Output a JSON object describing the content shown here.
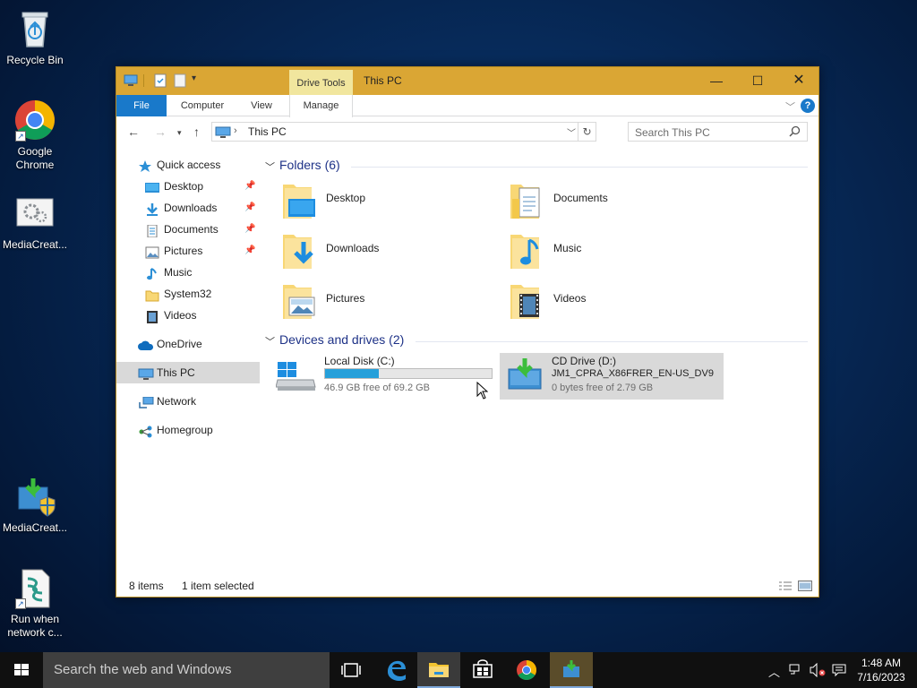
{
  "desktop": {
    "icons": [
      {
        "label": "Recycle Bin"
      },
      {
        "label": "Google Chrome"
      },
      {
        "label": "MediaCreat..."
      },
      {
        "label": "MediaCreat..."
      },
      {
        "label": "Run when network c..."
      }
    ]
  },
  "window": {
    "title": "This PC",
    "context_tab": "Drive Tools",
    "ribbon_tabs": [
      "File",
      "Computer",
      "View",
      "Manage"
    ],
    "help": "?",
    "address": {
      "path": "This PC"
    },
    "search": {
      "placeholder": "Search This PC"
    }
  },
  "navpane": {
    "items": [
      {
        "label": "Quick access"
      },
      {
        "label": "Desktop",
        "pinned": true
      },
      {
        "label": "Downloads",
        "pinned": true
      },
      {
        "label": "Documents",
        "pinned": true
      },
      {
        "label": "Pictures",
        "pinned": true
      },
      {
        "label": "Music"
      },
      {
        "label": "System32"
      },
      {
        "label": "Videos"
      },
      {
        "label": "OneDrive"
      },
      {
        "label": "This PC",
        "selected": true
      },
      {
        "label": "Network"
      },
      {
        "label": "Homegroup"
      }
    ]
  },
  "content": {
    "folders_header": "Folders (6)",
    "folders": [
      "Desktop",
      "Documents",
      "Downloads",
      "Music",
      "Pictures",
      "Videos"
    ],
    "devices_header": "Devices and drives (2)",
    "drives": [
      {
        "name": "Local Disk (C:)",
        "free_text": "46.9 GB free of 69.2 GB",
        "used_fraction": 0.32
      },
      {
        "name": "CD Drive (D:)",
        "label": "JM1_CPRA_X86FRER_EN-US_DV9",
        "free_text": "0 bytes free of 2.79 GB",
        "selected": true
      }
    ]
  },
  "statusbar": {
    "count": "8 items",
    "selection": "1 item selected"
  },
  "taskbar": {
    "search_placeholder": "Search the web and Windows",
    "time": "1:48 AM",
    "date": "7/16/2023"
  },
  "colors": {
    "titlebar": "#daa634",
    "drive_tools_tab": "#f1e69e",
    "file_tab": "#1979ca",
    "progress_fill": "#26a0da",
    "group_header_text": "#1e3287"
  }
}
